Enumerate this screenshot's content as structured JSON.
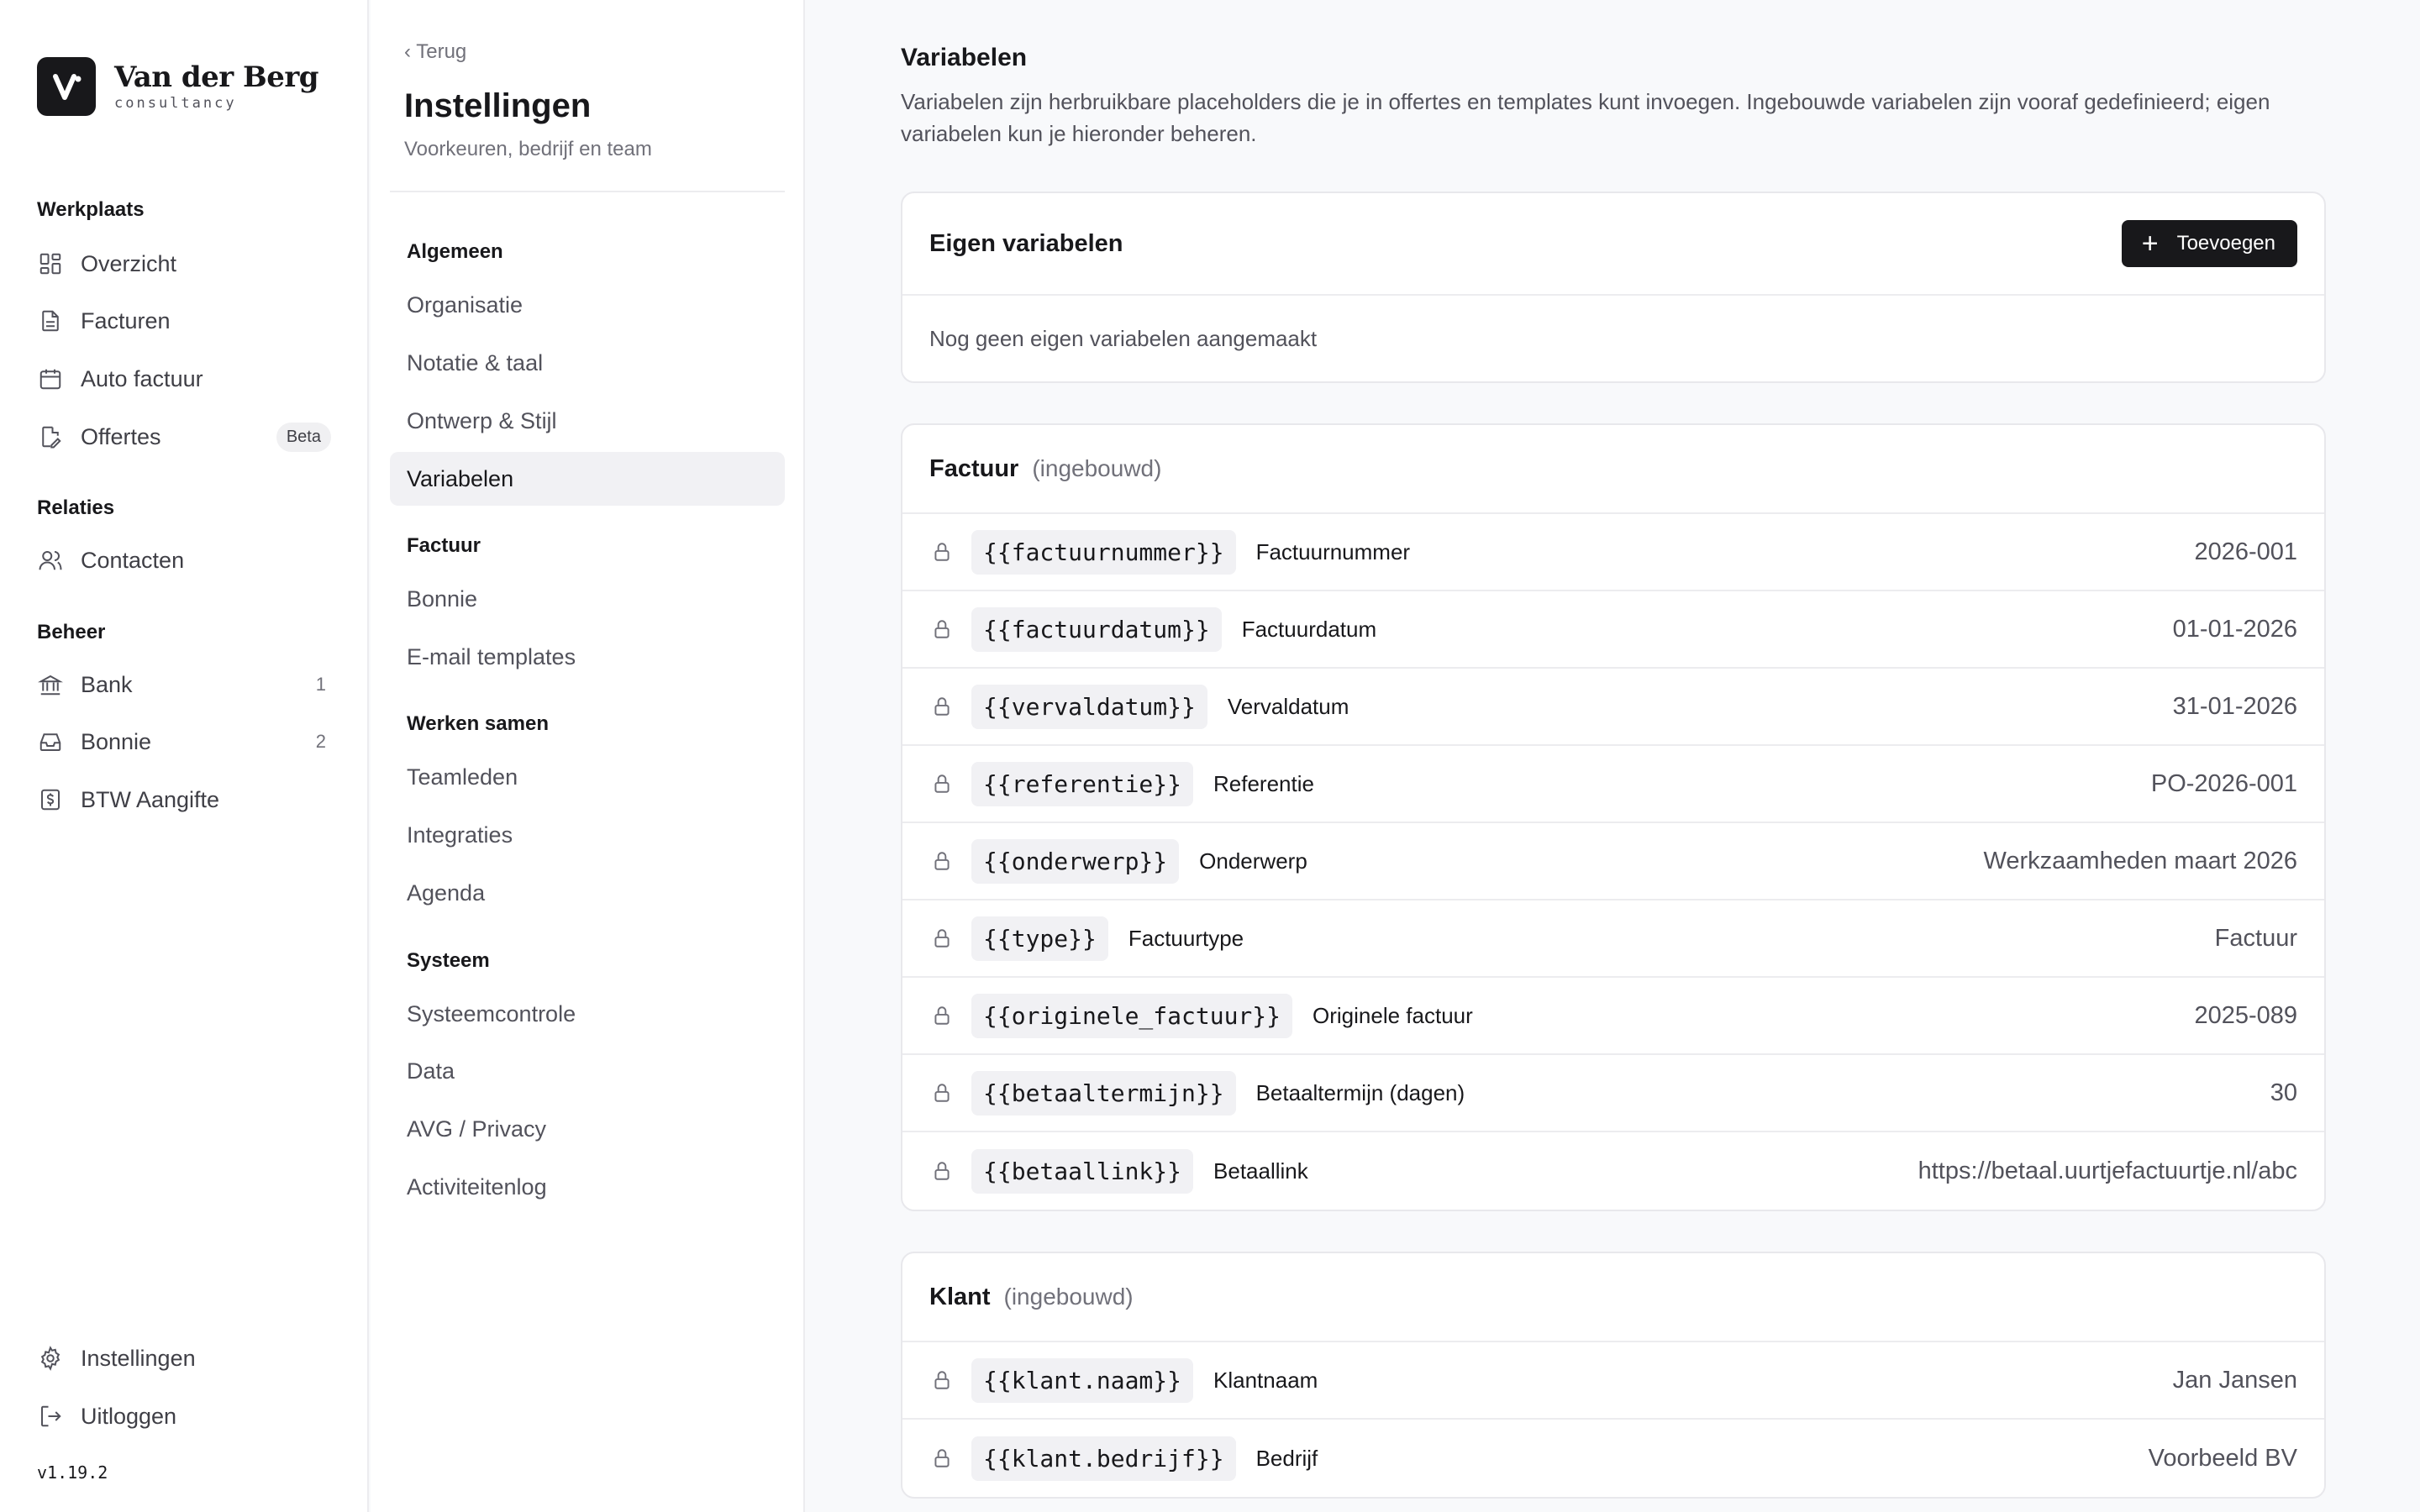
{
  "brand": {
    "name": "Van der Berg",
    "sub": "consultancy"
  },
  "nav": {
    "groups": [
      {
        "heading": "Werkplaats",
        "items": [
          {
            "label": "Overzicht",
            "icon": "dashboard-icon"
          },
          {
            "label": "Facturen",
            "icon": "document-icon"
          },
          {
            "label": "Auto factuur",
            "icon": "calendar-icon"
          },
          {
            "label": "Offertes",
            "icon": "document-edit-icon",
            "badge": "Beta"
          }
        ]
      },
      {
        "heading": "Relaties",
        "items": [
          {
            "label": "Contacten",
            "icon": "users-icon"
          }
        ]
      },
      {
        "heading": "Beheer",
        "items": [
          {
            "label": "Bank",
            "icon": "bank-icon",
            "count": "1"
          },
          {
            "label": "Bonnie",
            "icon": "inbox-icon",
            "count": "2"
          },
          {
            "label": "BTW Aangifte",
            "icon": "dollar-document-icon"
          }
        ]
      }
    ],
    "bottom": [
      {
        "label": "Instellingen",
        "icon": "gear-icon"
      },
      {
        "label": "Uitloggen",
        "icon": "logout-icon"
      }
    ],
    "version": "v1.19.2"
  },
  "settings": {
    "back": "‹ Terug",
    "title": "Instellingen",
    "subtitle": "Voorkeuren, bedrijf en team",
    "sections": [
      {
        "heading": "Algemeen",
        "items": [
          "Organisatie",
          "Notatie & taal",
          "Ontwerp & Stijl",
          "Variabelen"
        ]
      },
      {
        "heading": "Factuur",
        "items": [
          "Bonnie",
          "E-mail templates"
        ]
      },
      {
        "heading": "Werken samen",
        "items": [
          "Teamleden",
          "Integraties",
          "Agenda"
        ]
      },
      {
        "heading": "Systeem",
        "items": [
          "Systeemcontrole",
          "Data",
          "AVG / Privacy",
          "Activiteitenlog"
        ]
      }
    ],
    "active": "Variabelen"
  },
  "main": {
    "title": "Variabelen",
    "description": "Variabelen zijn herbruikbare placeholders die je in offertes en templates kunt invoegen. Ingebouwde variabelen zijn vooraf gedefinieerd; eigen variabelen kun je hieronder beheren.",
    "custom": {
      "title": "Eigen variabelen",
      "add_label": "Toevoegen",
      "empty": "Nog geen eigen variabelen aangemaakt"
    },
    "factuur": {
      "title": "Factuur",
      "tag": "(ingebouwd)",
      "rows": [
        {
          "code": "{{factuurnummer}}",
          "label": "Factuurnummer",
          "value": "2026-001"
        },
        {
          "code": "{{factuurdatum}}",
          "label": "Factuurdatum",
          "value": "01-01-2026"
        },
        {
          "code": "{{vervaldatum}}",
          "label": "Vervaldatum",
          "value": "31-01-2026"
        },
        {
          "code": "{{referentie}}",
          "label": "Referentie",
          "value": "PO-2026-001"
        },
        {
          "code": "{{onderwerp}}",
          "label": "Onderwerp",
          "value": "Werkzaamheden maart 2026"
        },
        {
          "code": "{{type}}",
          "label": "Factuurtype",
          "value": "Factuur"
        },
        {
          "code": "{{originele_factuur}}",
          "label": "Originele factuur",
          "value": "2025-089"
        },
        {
          "code": "{{betaaltermijn}}",
          "label": "Betaaltermijn (dagen)",
          "value": "30"
        },
        {
          "code": "{{betaallink}}",
          "label": "Betaallink",
          "value": "https://betaal.uurtjefactuurtje.nl/abc"
        }
      ]
    },
    "klant": {
      "title": "Klant",
      "tag": "(ingebouwd)",
      "rows": [
        {
          "code": "{{klant.naam}}",
          "label": "Klantnaam",
          "value": "Jan Jansen"
        },
        {
          "code": "{{klant.bedrijf}}",
          "label": "Bedrijf",
          "value": "Voorbeeld BV"
        }
      ]
    }
  }
}
